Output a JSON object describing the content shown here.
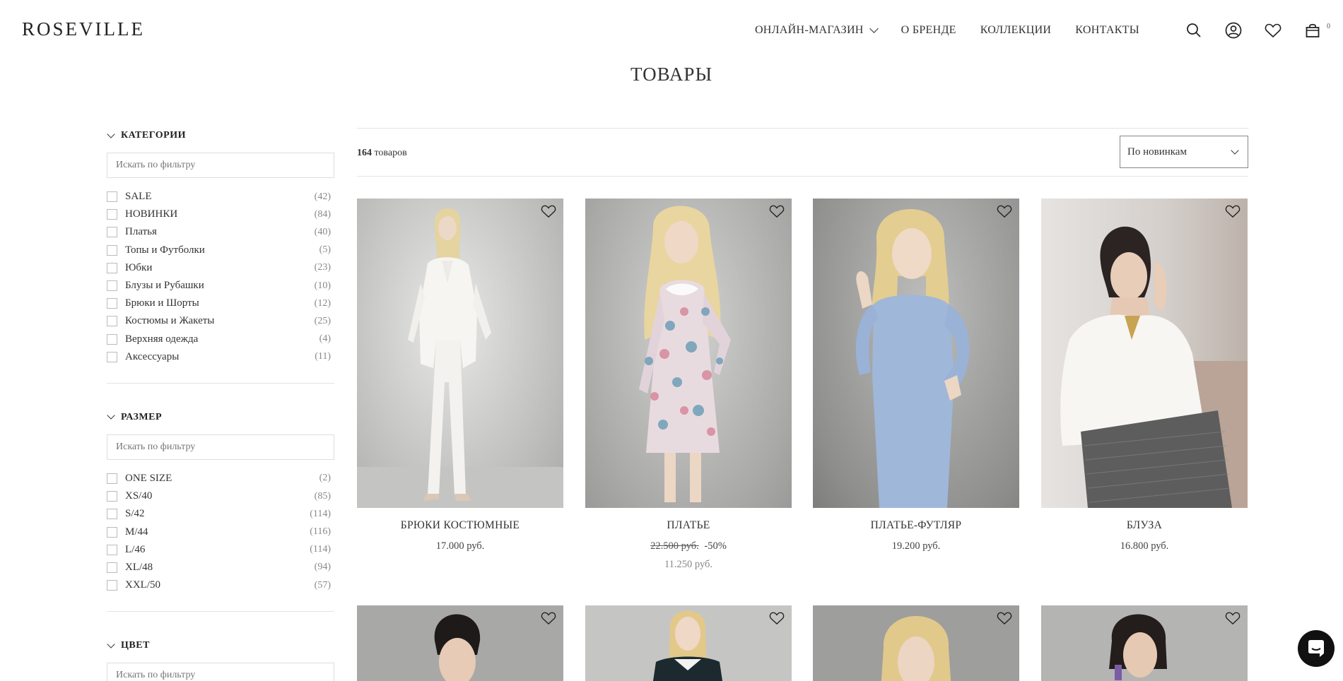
{
  "brand": "ROSEVILLE",
  "nav": {
    "items": [
      {
        "label": "ОНЛАЙН-МАГАЗИН",
        "has_dropdown": true
      },
      {
        "label": "О БРЕНДЕ"
      },
      {
        "label": "КОЛЛЕКЦИИ"
      },
      {
        "label": "КОНТАКТЫ"
      }
    ],
    "icons": [
      "search-icon",
      "account-icon",
      "heart-icon",
      "bag-icon"
    ],
    "cart_count": "0"
  },
  "page_title": "ТОВАРЫ",
  "filters": {
    "categories": {
      "title": "КАТЕГОРИИ",
      "search_placeholder": "Искать по фильтру",
      "items": [
        {
          "label": "SALE",
          "count": "(42)"
        },
        {
          "label": "НОВИНКИ",
          "count": "(84)"
        },
        {
          "label": "Платья",
          "count": "(40)"
        },
        {
          "label": "Топы и Футболки",
          "count": "(5)"
        },
        {
          "label": "Юбки",
          "count": "(23)"
        },
        {
          "label": "Блузы и Рубашки",
          "count": "(10)"
        },
        {
          "label": "Брюки и Шорты",
          "count": "(12)"
        },
        {
          "label": "Костюмы и Жакеты",
          "count": "(25)"
        },
        {
          "label": "Верхняя одежда",
          "count": "(4)"
        },
        {
          "label": "Аксессуары",
          "count": "(11)"
        }
      ]
    },
    "size": {
      "title": "РАЗМЕР",
      "search_placeholder": "Искать по фильтру",
      "items": [
        {
          "label": "ONE SIZE",
          "count": "(2)"
        },
        {
          "label": "XS/40",
          "count": "(85)"
        },
        {
          "label": "S/42",
          "count": "(114)"
        },
        {
          "label": "M/44",
          "count": "(116)"
        },
        {
          "label": "L/46",
          "count": "(114)"
        },
        {
          "label": "XL/48",
          "count": "(94)"
        },
        {
          "label": "XXL/50",
          "count": "(57)"
        }
      ]
    },
    "color": {
      "title": "ЦВЕТ",
      "search_placeholder": "Искать по фильтру"
    }
  },
  "toolbar": {
    "count_number": "164",
    "count_suffix": "товаров",
    "sort_value": "По новинкам"
  },
  "products": [
    {
      "name": "БРЮКИ КОСТЮМНЫЕ",
      "price": "17.000 руб."
    },
    {
      "name": "ПЛАТЬЕ",
      "old_price": "22.500 руб.",
      "discount": "-50%",
      "new_price": "11.250 руб."
    },
    {
      "name": "ПЛАТЬЕ-ФУТЛЯР",
      "price": "19.200 руб."
    },
    {
      "name": "БЛУЗА",
      "price": "16.800 руб."
    }
  ],
  "colors": {
    "text": "#222222",
    "muted": "#888888",
    "border": "#e3e3e3",
    "chat_button": "#111111"
  }
}
